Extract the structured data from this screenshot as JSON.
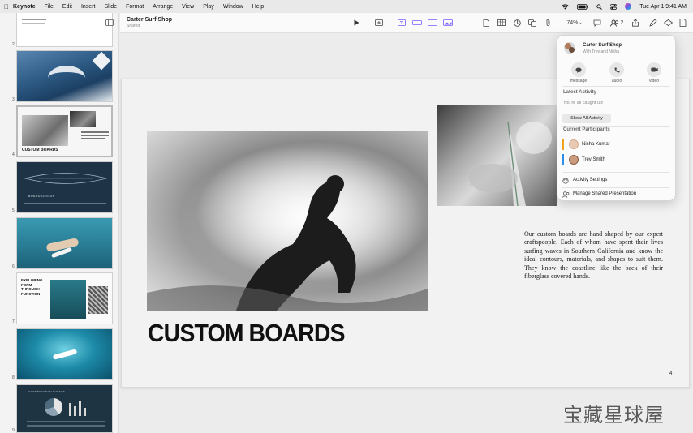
{
  "menubar": {
    "app_name": "Keynote",
    "items": [
      "File",
      "Edit",
      "Insert",
      "Slide",
      "Format",
      "Arrange",
      "View",
      "Play",
      "Window",
      "Help"
    ],
    "datetime": "Tue Apr 1  9:41 AM"
  },
  "document": {
    "title": "Carter Surf Shop",
    "subtitle": "Shared"
  },
  "toolbar": {
    "zoom": "74%",
    "collab_count": "2"
  },
  "sidebar": {
    "slide_numbers": [
      "2",
      "3",
      "4",
      "5",
      "6",
      "7",
      "8",
      "9"
    ],
    "slide4_title": "CUSTOM BOARDS",
    "slide5_title": "BOARD DESIGN",
    "slide7_title": "EXPLORING FORM THROUGH FUNCTION",
    "slide9_title": "CONSTRUCTION BUDGET"
  },
  "slide": {
    "title": "CUSTOM BOARDS",
    "body": "Our custom boards are hand shaped by our expert craftspeople. Each of whom have spent their lives surfing waves in Southern California and know the ideal contours, materials, and shapes to suit them. They know the coastline like the back of their fiberglass covered hands.",
    "page_number": "4"
  },
  "share_popover": {
    "group_name": "Carter Surf Shop",
    "group_members": "With Trev and Nisha",
    "actions": {
      "message": "message",
      "audio": "audio",
      "video": "video"
    },
    "latest_activity_heading": "Latest Activity",
    "latest_activity_status": "You're all caught up!",
    "show_all_label": "Show All Activity",
    "participants_heading": "Current Participants",
    "participants": [
      {
        "name": "Nisha Kumar",
        "color": "#f0a21f"
      },
      {
        "name": "Trev Smith",
        "color": "#2e8fe8"
      }
    ],
    "activity_settings": "Activity Settings",
    "manage_shared": "Manage Shared Presentation"
  },
  "watermark": "宝藏星球屋",
  "icons": [
    "apple-icon",
    "wifi-icon",
    "battery-icon",
    "search-icon",
    "control-center-icon",
    "siri-icon",
    "sidebar-toggle-icon",
    "play-icon",
    "add-slide-icon",
    "table-icon",
    "chart-icon",
    "text-icon",
    "shape-icon",
    "media-icon",
    "comment-icon",
    "collaborate-icon",
    "share-icon",
    "format-icon",
    "animate-icon",
    "document-icon"
  ],
  "colors": {
    "accent_orange": "#f0a21f",
    "accent_blue": "#2e8fe8"
  }
}
